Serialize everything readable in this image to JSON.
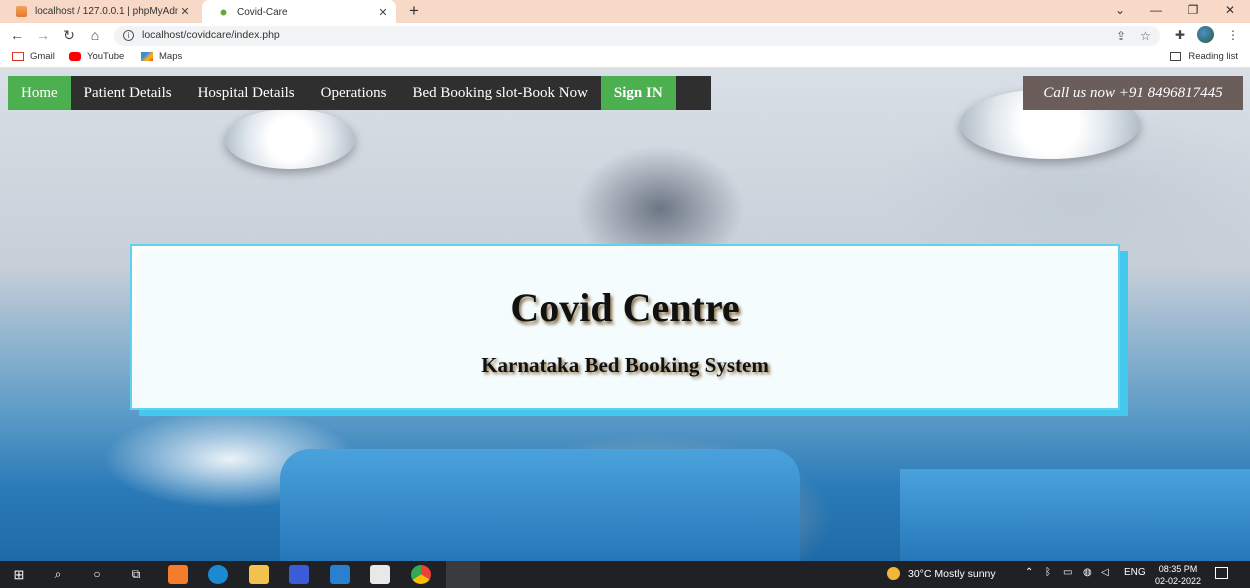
{
  "browser": {
    "tabs": [
      {
        "title": "localhost / 127.0.0.1 | phpMyAdm",
        "close": "✕"
      },
      {
        "title": "Covid-Care",
        "close": "✕"
      }
    ],
    "new_tab": "+",
    "window_controls": {
      "dropdown": "⌄",
      "minimize": "—",
      "maximize": "❐",
      "close": "✕"
    },
    "url": "localhost/covidcare/index.php",
    "bookmarks": [
      "Gmail",
      "YouTube",
      "Maps"
    ],
    "reading_list": "Reading list"
  },
  "site": {
    "nav": {
      "items": [
        "Home",
        "Patient Details",
        "Hospital Details",
        "Operations",
        "Bed Booking slot-Book Now"
      ],
      "signin": "Sign IN",
      "call_us": "Call us now +91 8496817445"
    },
    "hero": {
      "title": "Covid Centre",
      "subtitle": "Karnataka Bed Booking System"
    }
  },
  "taskbar": {
    "weather": "30°C  Mostly sunny",
    "language": "ENG",
    "time": "08:35 PM",
    "date": "02-02-2022"
  },
  "colors": {
    "nav_active": "#4caf50",
    "nav_bg": "#2f2f2f",
    "hero_border": "#5fd2f2",
    "call_bg": "#6b5d5a"
  }
}
